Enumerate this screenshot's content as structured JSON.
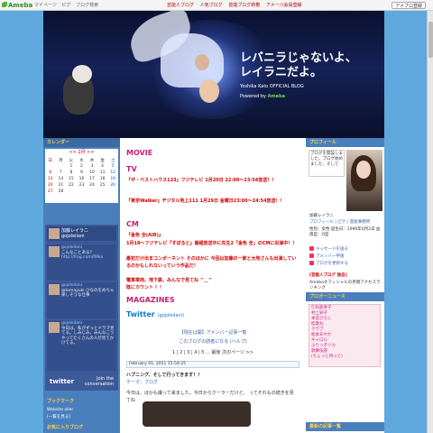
{
  "topbar": {
    "logo": "Ameba",
    "nav": [
      "マイページ",
      "ピグ",
      "ブログ検索"
    ],
    "mid": [
      "芸能人ブログ",
      "人気ブログ",
      "芸能ブログ新着",
      "アメーバ会員登録"
    ],
    "login": "アメブロ登録"
  },
  "banner": {
    "title_line1": "レバニラじゃないよ、",
    "title_line2": "レイラニだよ。",
    "subtitle": "Yoshika Kato OFFICIAL BLOG",
    "powered_label": "Powered by",
    "powered_brand": "Ameba"
  },
  "left": {
    "calendar_header": "カレンダー",
    "calendar_month": "<< 2月 >>",
    "weekdays": [
      "日",
      "月",
      "火",
      "水",
      "木",
      "金",
      "土"
    ],
    "weeks": [
      [
        "",
        "",
        "1",
        "2",
        "3",
        "4",
        "5"
      ],
      [
        "6",
        "7",
        "8",
        "9",
        "10",
        "11",
        "12"
      ],
      [
        "13",
        "14",
        "15",
        "16",
        "17",
        "18",
        "19"
      ],
      [
        "20",
        "21",
        "22",
        "23",
        "24",
        "25",
        "26"
      ],
      [
        "27",
        "28",
        "",
        "",
        "",
        "",
        ""
      ]
    ],
    "twitter_name": "加藤レイラニ",
    "twitter_handle": "gojoleilani",
    "tweets": [
      {
        "user": "gojoleilani",
        "text": "こんなことある?",
        "link": "http://frog.com/fl9ka"
      },
      {
        "user": "gojoleilani",
        "text": "@tomayuki ひなのをめちゃ楽しそうな仕事"
      },
      {
        "user": "gojoleilani",
        "text": "今日は、私がずっとドラマ見てる。しみじみ、みんなこうやってたくさんの人が見てかけてる。"
      }
    ],
    "twitter_logo": "twitter",
    "join_line1": "Join the",
    "join_line2": "conversation",
    "bookmark_header": "ブックマーク",
    "bookmark_items": [
      "Website aller",
      "[一覧を見る]"
    ],
    "blog_header": "お気に入りブログ"
  },
  "center": {
    "movie": "MOVIE",
    "tv": "TV",
    "tv_lines": [
      "『ザ・ベストハウス123』フジテレビ 1月20日 22:00〜23:54放送！！",
      "『東京Walker』ヂジタル地上111 1月29日 金曜日23:00〜24:54放送！！"
    ],
    "cm": "CM",
    "cm_lines": [
      "『金色 全(AIR)』",
      "1月18〜フジテレビ『すぽると』番組放送中に先生2「金色 全」のCMに出演中！！",
      "最初だけ出まコンポーネント  そのほかに 今回は加藤の一家と大地さんも出演しているのかもしれないっていう作品だ！",
      "電車車両、地下鉄、みんなで見てね ^＿^",
      "既にカウント ！！"
    ],
    "magazines": "MAGAZINES",
    "twitter_label": "Twitter",
    "twitter_handle": "(gojoleilani)",
    "link1": "【現在は開】アメンバー記事一覧",
    "link2": "このブログの読者になる (ヘルプ)",
    "pages": [
      "1",
      "2",
      "3",
      "4",
      "5",
      "...",
      "最後",
      "次のページ >>"
    ],
    "date": "February 01, 2011 15:54:25",
    "entry_title": "ハプニング、そして行ってきます！！",
    "entry_tag": "テーマ：ブログ",
    "entry_text": "今日は、ほかも撮って来ました。今日からクーラーだけど、 ってそれもの続きを見てね"
  },
  "right": {
    "profile_header": "プロフィール",
    "profile_bubble": "ブログを開設しました。ブログ始めました、そして",
    "profile_caption": "加藤レイラニ",
    "profile_links": [
      "プロフィール",
      "ピグ",
      "芸能事務所"
    ],
    "profile_text": "性別：女性 誕生日：1990年6月2日 血液型：O型",
    "btn1": "メッセージを送る",
    "btn2": "アメンバー申請",
    "btn3": "ブログを更新する",
    "ranking_header": "[芸能人ブログ 独自]",
    "ranking_text": "Amebaオフィシャルの月間アクセスランキング",
    "blogger_header": "ブロガーニュース",
    "blogger_items": [
      "仁科亜季子",
      "村上知子",
      "本宮ひろし",
      "桂歌丸",
      "クラブ",
      "松本あやか",
      "キャロル",
      "ぶりっ子リカ",
      "歌舞伎座",
      "(ちょっと待って)"
    ],
    "latest_header": "最新の記事一覧"
  }
}
